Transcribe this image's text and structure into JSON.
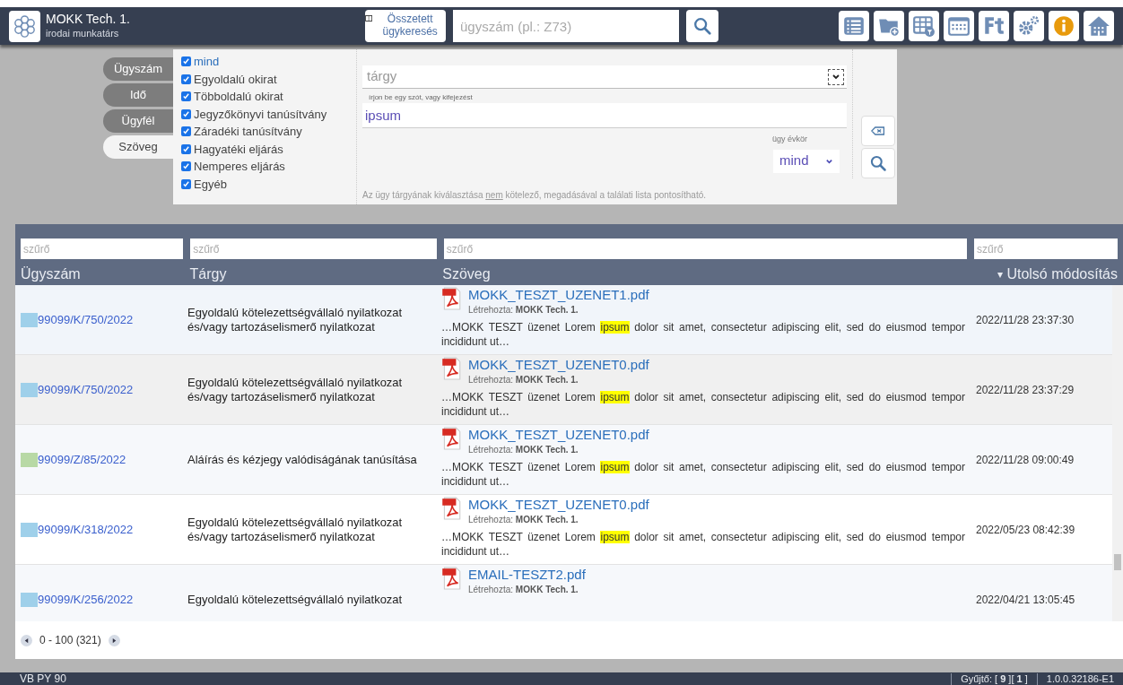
{
  "user": {
    "name": "MOKK Tech. 1.",
    "role": "irodai munkatárs"
  },
  "header": {
    "complex_search": "Összetett ügykeresés",
    "search_placeholder": "ügyszám (pl.: Z73)"
  },
  "search_tabs": [
    {
      "label": "Ügyszám",
      "selected": false
    },
    {
      "label": "Idő",
      "selected": false
    },
    {
      "label": "Ügyfél",
      "selected": false
    },
    {
      "label": "Szöveg",
      "selected": true
    }
  ],
  "doc_types": [
    {
      "label": "mind",
      "checked": true
    },
    {
      "label": "Egyoldalú okirat",
      "checked": true
    },
    {
      "label": "Többoldalú okirat",
      "checked": true
    },
    {
      "label": "Jegyzőkönyvi tanúsítvány",
      "checked": true
    },
    {
      "label": "Záradéki tanúsítvány",
      "checked": true
    },
    {
      "label": "Hagyatéki eljárás",
      "checked": true
    },
    {
      "label": "Nemperes eljárás",
      "checked": true
    },
    {
      "label": "Egyéb",
      "checked": true
    }
  ],
  "subject_placeholder": "tárgy",
  "text_hint": "írjon be egy szót, vagy kifejezést",
  "text_value": "ipsum",
  "year_label": "ügy évkör",
  "year_value": "mind",
  "note": {
    "before": "Az ügy tárgyának kiválasztása ",
    "underlined": "nem",
    "after": " kötelező, megadásával a találati lista pontosítható."
  },
  "table": {
    "filter_placeholders": [
      "szűrő",
      "szűrő",
      "szűrő",
      "szűrő"
    ],
    "columns": [
      "Ügyszám",
      "Tárgy",
      "Szöveg",
      "Utolsó módosítás"
    ],
    "sort_mark": "▾",
    "rows": [
      {
        "case": "99099/K/750/2022",
        "color": "#9fd0ea",
        "subject": "Egyoldalú kötelezettségvállaló nyilatkozat és/vagy tartozáselismerő nyilatkozat",
        "file": "MOKK_TESZT_UZENET1.pdf",
        "created_label": "Létrehozta:",
        "created_by": "MOKK Tech. 1.",
        "snippet": {
          "before": "…MOKK TESZT üzenet Lorem ",
          "match": "ipsum",
          "after": " dolor sit amet, consectetur adipiscing elit, sed do eiusmod tempor incididunt ut…"
        },
        "modified": "2022/11/28 23:37:30"
      },
      {
        "case": "99099/K/750/2022",
        "color": "#9fd0ea",
        "subject": "Egyoldalú kötelezettségvállaló nyilatkozat és/vagy tartozáselismerő nyilatkozat",
        "file": "MOKK_TESZT_UZENET0.pdf",
        "created_label": "Létrehozta:",
        "created_by": "MOKK Tech. 1.",
        "snippet": {
          "before": "…MOKK TESZT üzenet Lorem ",
          "match": "ipsum",
          "after": " dolor sit amet, consectetur adipiscing elit, sed do eiusmod tempor incididunt ut…"
        },
        "modified": "2022/11/28 23:37:29"
      },
      {
        "case": "99099/Z/85/2022",
        "color": "#b8d9a5",
        "subject": "Aláírás és kézjegy valódiságának tanúsítása",
        "file": "MOKK_TESZT_UZENET0.pdf",
        "created_label": "Létrehozta:",
        "created_by": "MOKK Tech. 1.",
        "snippet": {
          "before": "…MOKK TESZT üzenet Lorem ",
          "match": "ipsum",
          "after": " dolor sit amet, consectetur adipiscing elit, sed do eiusmod tempor incididunt ut…"
        },
        "modified": "2022/11/28 09:00:49"
      },
      {
        "case": "99099/K/318/2022",
        "color": "#9fd0ea",
        "subject": "Egyoldalú kötelezettségvállaló nyilatkozat és/vagy tartozáselismerő nyilatkozat",
        "file": "MOKK_TESZT_UZENET0.pdf",
        "created_label": "Létrehozta:",
        "created_by": "MOKK Tech. 1.",
        "snippet": {
          "before": "…MOKK TESZT üzenet Lorem ",
          "match": "ipsum",
          "after": " dolor sit amet, consectetur adipiscing elit, sed do eiusmod tempor incididunt ut…"
        },
        "modified": "2022/05/23 08:42:39"
      },
      {
        "case": "99099/K/256/2022",
        "color": "#9fd0ea",
        "subject": "Egyoldalú kötelezettségvállaló nyilatkozat",
        "file": "EMAIL-TESZT2.pdf",
        "created_label": "Létrehozta:",
        "created_by": "MOKK Tech. 1.",
        "modified": "2022/04/21 13:05:45"
      }
    ]
  },
  "pagination": "0 - 100 (321)",
  "status_bar": {
    "left": "VB PY 90",
    "collector_label": "Gyűjtő:",
    "collector_open": "[",
    "collector_a": "9",
    "collector_mid": "][",
    "collector_b": "1",
    "collector_close": "]",
    "version": "1.0.0.32186-E1"
  }
}
